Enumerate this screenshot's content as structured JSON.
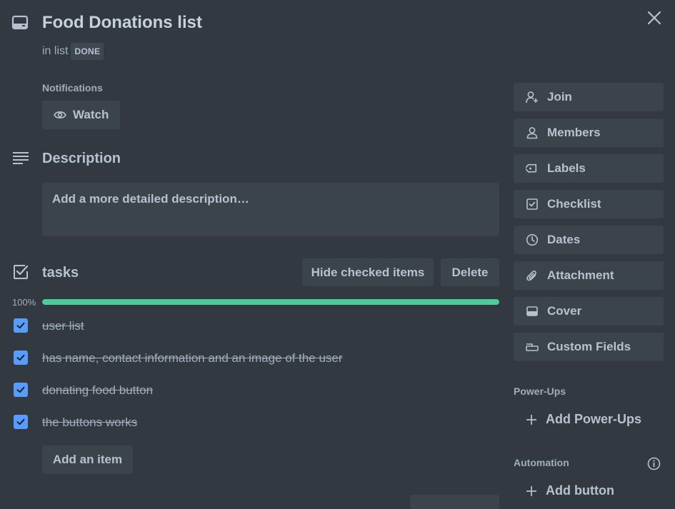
{
  "card": {
    "title": "Food Donations list",
    "in_list_prefix": "in list",
    "list_name": "DONE",
    "icons": {
      "card": "card-icon",
      "close": "close-icon"
    }
  },
  "notifications": {
    "label": "Notifications",
    "watch_label": "Watch",
    "icon": "eye-icon"
  },
  "description": {
    "title": "Description",
    "placeholder": "Add a more detailed description…",
    "icon": "description-icon"
  },
  "checklist": {
    "title": "tasks",
    "hide_checked_label": "Hide checked items",
    "delete_label": "Delete",
    "progress_text": "100%",
    "progress_value": 1.0,
    "items": [
      {
        "text": "user list",
        "checked": true
      },
      {
        "text": "has name, contact information and an image of the user",
        "checked": true
      },
      {
        "text": "donating food button",
        "checked": true
      },
      {
        "text": "the buttons works",
        "checked": true
      }
    ],
    "add_item_label": "Add an item"
  },
  "sidebar": {
    "actions": [
      {
        "label": "Join",
        "icon": "join-icon"
      },
      {
        "label": "Members",
        "icon": "members-icon"
      },
      {
        "label": "Labels",
        "icon": "label-icon"
      },
      {
        "label": "Checklist",
        "icon": "checklist-icon"
      },
      {
        "label": "Dates",
        "icon": "clock-icon"
      },
      {
        "label": "Attachment",
        "icon": "paperclip-icon"
      },
      {
        "label": "Cover",
        "icon": "cover-icon"
      },
      {
        "label": "Custom Fields",
        "icon": "custom-fields-icon"
      }
    ],
    "powerups": {
      "label": "Power-Ups",
      "add_label": "Add Power-Ups"
    },
    "automation": {
      "label": "Automation",
      "add_button_label": "Add button"
    }
  },
  "colors": {
    "background": "#323940",
    "button": "#3b434b",
    "progress": "#4bce97",
    "checkbox": "#579dff",
    "text": "#b6c2cf"
  }
}
